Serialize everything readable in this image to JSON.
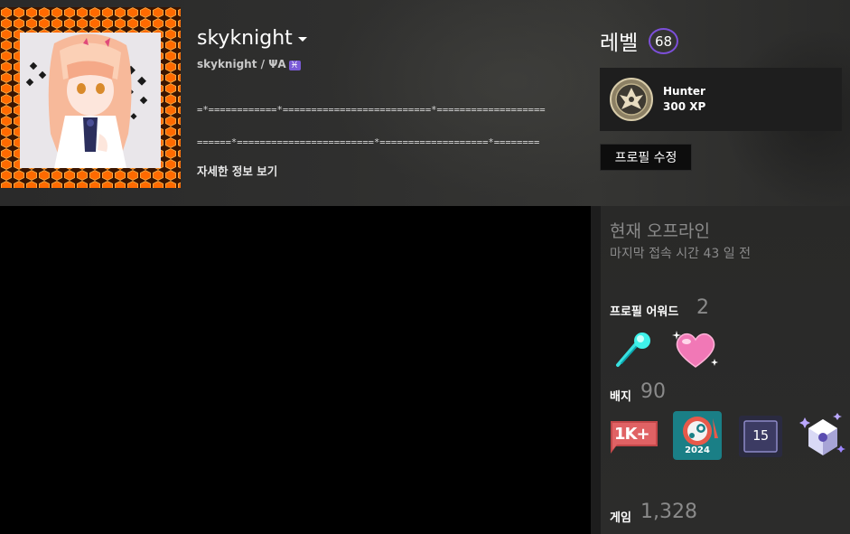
{
  "profile": {
    "persona_name": "skyknight",
    "real_name": "skyknight / ΨA",
    "zodiac_symbol": "♓",
    "summary_lines": [
      "=*============*==========================*===================",
      "======*========================*===================*========"
    ],
    "more_info_label": "자세한 정보 보기"
  },
  "level": {
    "label": "레벨",
    "value": "68",
    "ring_color": "#7c4fd9"
  },
  "xp_badge": {
    "title": "Hunter",
    "xp": "300 XP",
    "icon": "warframe-hunter-emblem-icon"
  },
  "edit_profile_label": "프로필 수정",
  "status": {
    "state": "현재 오프라인",
    "last_online": "마지막 접속 시간 43 일 전"
  },
  "awards": {
    "label": "프로필 어워드",
    "count": "2",
    "items": [
      "comet-award-icon",
      "heart-award-icon"
    ]
  },
  "badges": {
    "label": "배지",
    "count": "90",
    "items": [
      {
        "icon": "1k-plus-badge-icon",
        "text": "1K+"
      },
      {
        "icon": "steam-2024-badge-icon",
        "text": "2024"
      },
      {
        "icon": "years-of-service-badge-icon",
        "text": "15"
      },
      {
        "icon": "crystal-puzzle-badge-icon",
        "text": ""
      }
    ]
  },
  "games": {
    "label": "게임",
    "count": "1,328"
  },
  "colors": {
    "avatar_frame": "#ff6a00",
    "header_bg": "#2f2f2e",
    "panel_bg": "#2a2a29",
    "muted_text": "#8a8a8a"
  }
}
